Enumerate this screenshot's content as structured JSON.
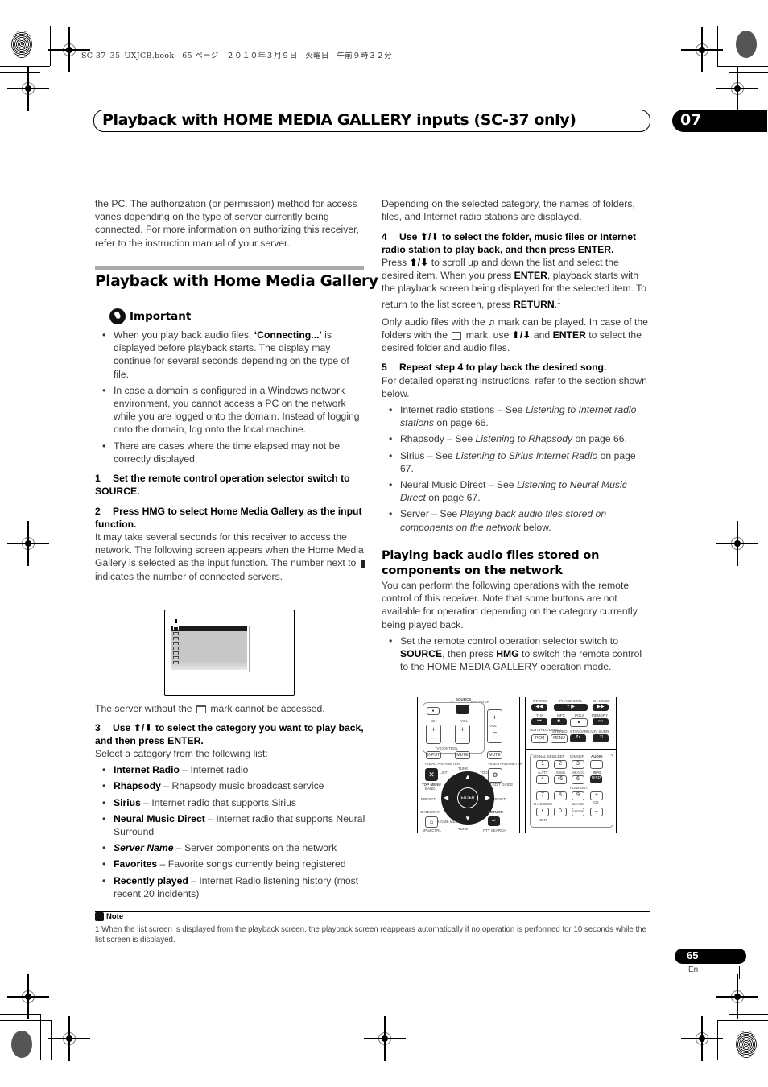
{
  "print_header": "SC-37_35_UXJCB.book　65 ページ　２０１０年３月９日　火曜日　午前９時３２分",
  "chapter": {
    "title": "Playback with HOME MEDIA GALLERY inputs (SC-37 only)",
    "number": "07"
  },
  "left": {
    "intro": "the PC. The authorization (or permission) method for access varies depending on the type of server currently being connected. For more information on authorizing this receiver, refer to the instruction manual of your server.",
    "section_title": "Playback with Home Media Gallery",
    "important": {
      "label": "Important",
      "items": [
        {
          "pre": "When you play back audio files, ",
          "bold": "‘Connecting...’",
          "post": " is displayed before playback starts. The display may continue for several seconds depending on the type of file."
        },
        {
          "text": "In case a domain is configured in a Windows network environment, you cannot access a PC on the network while you are logged onto the domain. Instead of logging onto the domain, log onto the local machine."
        },
        {
          "text": "There are cases where the time elapsed may not be correctly displayed."
        }
      ]
    },
    "step1": {
      "num": "1",
      "text": "Set the remote control operation selector switch to SOURCE."
    },
    "step2": {
      "num": "2",
      "text": "Press HMG to select Home Media Gallery as the input function.",
      "body_a": "It may take several seconds for this receiver to access the network. The following screen appears when the Home Media Gallery is selected as the input function. The number next to ",
      "body_b": " indicates the number of connected servers."
    },
    "screen_caption_a": "The server without the ",
    "screen_caption_b": " mark cannot be accessed.",
    "step3": {
      "num": "3",
      "text_a": "Use ",
      "arrows": "⬆/⬇",
      "text_b": " to select the category you want to play back, and then press ENTER.",
      "body": "Select a category from the following list:",
      "categories": [
        {
          "name": "Internet Radio",
          "desc": " – Internet radio"
        },
        {
          "name": "Rhapsody",
          "desc": " – Rhapsody music broadcast service"
        },
        {
          "name": "Sirius",
          "desc": " – Internet radio that supports Sirius"
        },
        {
          "name": "Neural Music Direct",
          "desc": " – Internet radio that supports Neural Surround"
        },
        {
          "name": "Server Name",
          "desc": " – Server components on the network",
          "italic": true
        },
        {
          "name": "Favorites",
          "desc": " – Favorite songs currently being registered"
        },
        {
          "name": "Recently played",
          "desc": " – Internet Radio listening history (most recent 20 incidents)"
        }
      ]
    }
  },
  "right": {
    "intro": "Depending on the selected category, the names of folders, files, and Internet radio stations are displayed.",
    "step4": {
      "num": "4",
      "text_a": "Use ",
      "arrows": "⬆/⬇",
      "text_b": " to select the folder, music files or Internet radio station to play back, and then press ENTER.",
      "body_1": "Press ",
      "body_2": " to scroll up and down the list and select the desired item. When you press ",
      "enter": "ENTER",
      "body_3": ", playback starts with the playback screen being displayed for the selected item. To return to the list screen, press ",
      "return": "RETURN",
      "body_4": ".",
      "footnote_ref": "1",
      "para2_a": "Only audio files with the ",
      "music_icon": "♫",
      "para2_b": " mark can be played. In case of the folders with the ",
      "para2_c": " mark, use ",
      "para2_d": " and ",
      "para2_e": " to select the desired folder and audio files."
    },
    "step5": {
      "num": "5",
      "text": "Repeat step 4 to play back the desired song.",
      "body": "For detailed operating instructions, refer to the section shown below.",
      "refs": [
        {
          "pre": "Internet radio stations – See ",
          "ital": "Listening to Internet radio stations",
          "post": " on page 66."
        },
        {
          "pre": "Rhapsody – See ",
          "ital": "Listening to Rhapsody",
          "post": " on page 66."
        },
        {
          "pre": "Sirius – See ",
          "ital": "Listening to Sirius Internet Radio",
          "post": " on page 67."
        },
        {
          "pre": "Neural Music Direct – See ",
          "ital": "Listening to Neural Music Direct",
          "post": " on page 67."
        },
        {
          "pre": "Server – See ",
          "ital": "Playing back audio files stored on components on the network",
          "post": " below."
        }
      ]
    },
    "subsection_title": "Playing back audio files stored on components on the network",
    "subsection_body": "You can perform the following operations with the remote control of this receiver. Note that some buttons are not available for operation depending on the category currently being played back.",
    "bullet": {
      "a": "Set the remote control operation selector switch to ",
      "source": "SOURCE",
      "b": ", then press ",
      "hmg": "HMG",
      "c": " to switch the remote control to the HOME MEDIA GALLERY operation mode."
    }
  },
  "remote": {
    "source_switch": {
      "left": "TV",
      "top": "SOURCE",
      "right": "RECEIVER"
    },
    "ch": "CH",
    "vol": "VOL",
    "tv_control": "TV CONTROL",
    "input": "INPUT",
    "mute": "MUTE",
    "audio_param": "AUDIO PARAMETER",
    "video_param": "VIDEO PARAMETER",
    "list": "LIST",
    "tools": "TOOLS",
    "top_menu": "TOP MENU",
    "band": "BAND",
    "t_edit": "T.EDIT GUIDE",
    "tune": "TUNE",
    "preset": "PRESET",
    "enter": "ENTER",
    "category": "CATEGORY",
    "home_menu": "HOME MENU",
    "ipod_ctrl": "iPod CTRL",
    "return": "RETURN",
    "pty_search": "PTY SEARCH",
    "top_labels": [
      "STATUS",
      "PHASE CTRL",
      "CH LEVEL",
      "THX",
      "MPX",
      "PQLS",
      "MEMORY",
      "AUTO/ALC/DIRECT",
      "STEREO",
      "STANDARD",
      "ADV SURR"
    ],
    "pgm": "PGM",
    "menu": "MENU",
    "num_labels": [
      "SIGNAL SEL",
      "SLEEP",
      "DIMMER",
      "AUDIO",
      "A.ATT",
      "SBch",
      "MCACC",
      "INFO",
      "HDMI OUT",
      "D.ACCESS",
      "CLASS",
      "CH",
      "CLR"
    ],
    "keys": [
      "1",
      "2",
      "3",
      "",
      "4",
      "•5",
      "6",
      "DISP",
      "7",
      "8",
      "9",
      "+",
      "•",
      "0",
      "ENTER",
      "–"
    ]
  },
  "footnote": {
    "label": "Note",
    "text": "1 When the list screen is displayed from the playback screen, the playback screen reappears automatically if no operation is performed for 10 seconds while the list screen is displayed."
  },
  "page": {
    "number": "65",
    "lang": "En"
  }
}
